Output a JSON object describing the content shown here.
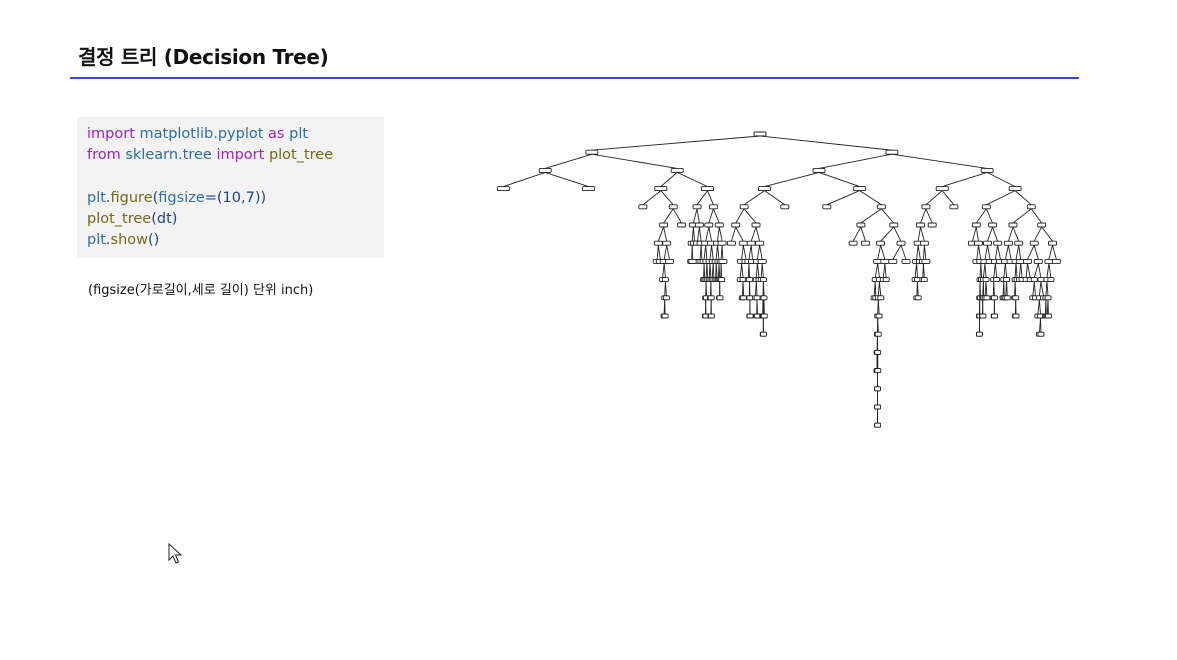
{
  "slide": {
    "title": "결정 트리 (Decision Tree)"
  },
  "code": {
    "lines": [
      [
        {
          "t": "import",
          "k": "kw"
        },
        {
          "t": " ",
          "k": "pun"
        },
        {
          "t": "matplotlib.pyplot",
          "k": "mod"
        },
        {
          "t": " ",
          "k": "pun"
        },
        {
          "t": "as",
          "k": "kw"
        },
        {
          "t": " ",
          "k": "pun"
        },
        {
          "t": "plt",
          "k": "mod"
        }
      ],
      [
        {
          "t": "from",
          "k": "kw"
        },
        {
          "t": " ",
          "k": "pun"
        },
        {
          "t": "sklearn.tree",
          "k": "mod"
        },
        {
          "t": " ",
          "k": "pun"
        },
        {
          "t": "import",
          "k": "kw"
        },
        {
          "t": " ",
          "k": "pun"
        },
        {
          "t": "plot_tree",
          "k": "fn"
        }
      ],
      [],
      [
        {
          "t": "plt",
          "k": "id"
        },
        {
          "t": ".",
          "k": "pun"
        },
        {
          "t": "figure",
          "k": "fn"
        },
        {
          "t": "(",
          "k": "pun"
        },
        {
          "t": "figsize",
          "k": "id"
        },
        {
          "t": "=(10,7))",
          "k": "pun"
        }
      ],
      [
        {
          "t": "plot_tree",
          "k": "fn"
        },
        {
          "t": "(dt)",
          "k": "pun"
        }
      ],
      [
        {
          "t": "plt",
          "k": "id"
        },
        {
          "t": ".",
          "k": "pun"
        },
        {
          "t": "show",
          "k": "fn"
        },
        {
          "t": "()",
          "k": "pun"
        }
      ]
    ]
  },
  "note": {
    "text": "(figsize(가로길이,세로 길이) 단위 inch)"
  },
  "tree": {
    "depth": 18,
    "node_fill": "#ffffff",
    "node_stroke": "#222222",
    "edge_color": "#222222"
  },
  "colors": {
    "title_rule": "#3a47c8",
    "code_background": "#f3f3f3"
  }
}
